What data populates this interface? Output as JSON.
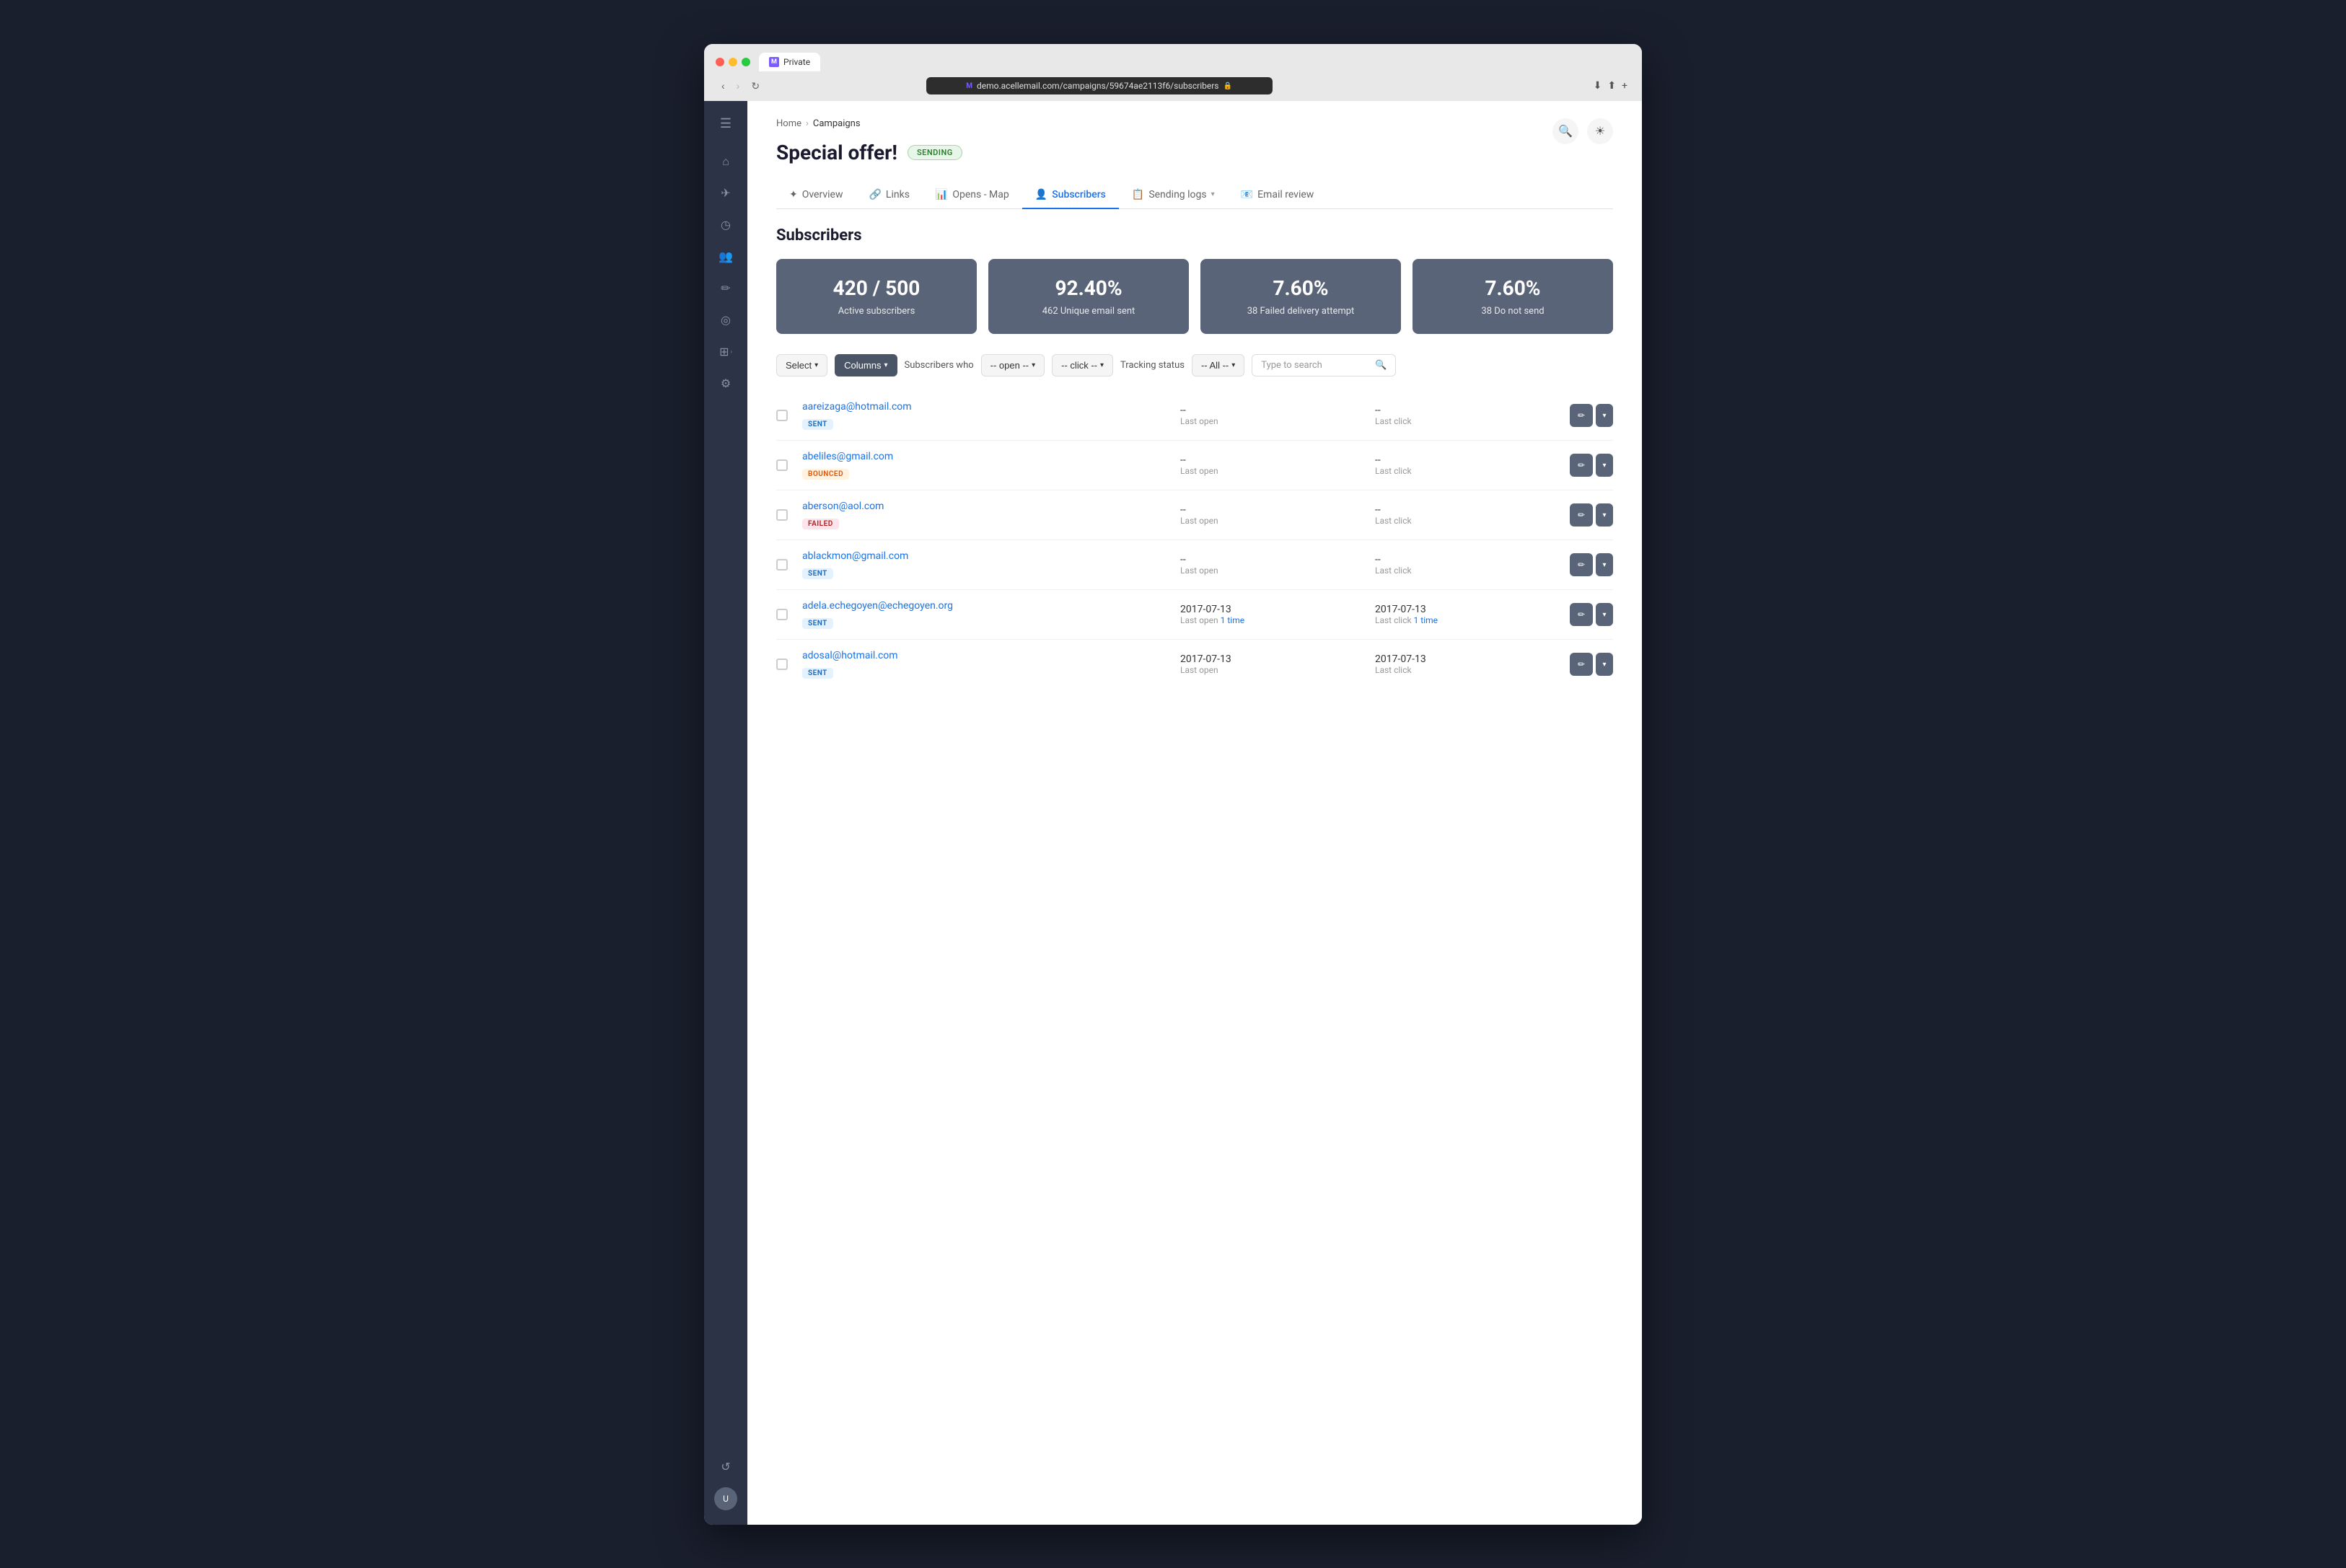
{
  "browser": {
    "tab_label": "Private",
    "url": "demo.acellemail.com/campaigns/59674ae2113f6/subscribers",
    "favicon": "M"
  },
  "breadcrumb": {
    "home": "Home",
    "separator": "›",
    "campaigns": "Campaigns"
  },
  "page": {
    "title": "Special offer!",
    "status_badge": "SENDING"
  },
  "tabs": [
    {
      "id": "overview",
      "label": "Overview",
      "icon": "✦",
      "active": false
    },
    {
      "id": "links",
      "label": "Links",
      "icon": "🔗",
      "active": false
    },
    {
      "id": "opens-map",
      "label": "Opens - Map",
      "icon": "📊",
      "active": false
    },
    {
      "id": "subscribers",
      "label": "Subscribers",
      "icon": "👤",
      "active": true
    },
    {
      "id": "sending-logs",
      "label": "Sending logs",
      "icon": "📋",
      "active": false
    },
    {
      "id": "email-review",
      "label": "Email review",
      "icon": "📧",
      "active": false
    }
  ],
  "section_title": "Subscribers",
  "stats": [
    {
      "value": "420 / 500",
      "label": "Active subscribers"
    },
    {
      "value": "92.40%",
      "label": "462 Unique email sent"
    },
    {
      "value": "7.60%",
      "label": "38 Failed delivery attempt"
    },
    {
      "value": "7.60%",
      "label": "38 Do not send"
    }
  ],
  "filters": {
    "select_label": "Select",
    "columns_label": "Columns",
    "subscribers_who_label": "Subscribers who",
    "open_label": "-- open --",
    "click_label": "-- click --",
    "tracking_label": "Tracking status",
    "all_label": "-- All --",
    "search_placeholder": "Type to search"
  },
  "subscribers": [
    {
      "email": "aareizaga@hotmail.com",
      "tag": "SENT",
      "tag_type": "sent",
      "last_open_val": "--",
      "last_open_label": "Last open",
      "last_click_val": "--",
      "last_click_label": "Last click"
    },
    {
      "email": "abeliles@gmail.com",
      "tag": "BOUNCED",
      "tag_type": "bounced",
      "last_open_val": "--",
      "last_open_label": "Last open",
      "last_click_val": "--",
      "last_click_label": "Last click"
    },
    {
      "email": "aberson@aol.com",
      "tag": "FAILED",
      "tag_type": "failed",
      "last_open_val": "--",
      "last_open_label": "Last open",
      "last_click_val": "--",
      "last_click_label": "Last click"
    },
    {
      "email": "ablackmon@gmail.com",
      "tag": "SENT",
      "tag_type": "sent",
      "last_open_val": "--",
      "last_open_label": "Last open",
      "last_click_val": "--",
      "last_click_label": "Last click"
    },
    {
      "email": "adela.echegoyen@echegoyen.org",
      "tag": "SENT",
      "tag_type": "sent",
      "last_open_val": "2017-07-13",
      "last_open_label": "Last open 1 time",
      "last_open_time_link": true,
      "last_click_val": "2017-07-13",
      "last_click_label": "Last click 1 time",
      "last_click_time_link": true
    },
    {
      "email": "adosal@hotmail.com",
      "tag": "SENT",
      "tag_type": "sent",
      "last_open_val": "2017-07-13",
      "last_open_label": "Last open",
      "last_click_val": "2017-07-13",
      "last_click_label": "Last click"
    }
  ],
  "sidebar": {
    "icons": [
      {
        "id": "menu",
        "symbol": "☰",
        "label": "menu-toggle"
      },
      {
        "id": "home",
        "symbol": "⌂",
        "label": "home-icon"
      },
      {
        "id": "send",
        "symbol": "✈",
        "label": "send-icon"
      },
      {
        "id": "clock",
        "symbol": "◷",
        "label": "clock-icon"
      },
      {
        "id": "contacts",
        "symbol": "👥",
        "label": "contacts-icon"
      },
      {
        "id": "edit",
        "symbol": "✏",
        "label": "edit-icon"
      },
      {
        "id": "analytics",
        "symbol": "◎",
        "label": "analytics-icon"
      },
      {
        "id": "reports",
        "symbol": "⊞",
        "label": "reports-icon"
      },
      {
        "id": "settings",
        "symbol": "⚙",
        "label": "settings-icon"
      }
    ],
    "bottom_icons": [
      {
        "id": "history",
        "symbol": "↺",
        "label": "history-icon"
      },
      {
        "id": "avatar",
        "symbol": "U",
        "label": "user-avatar"
      }
    ]
  }
}
